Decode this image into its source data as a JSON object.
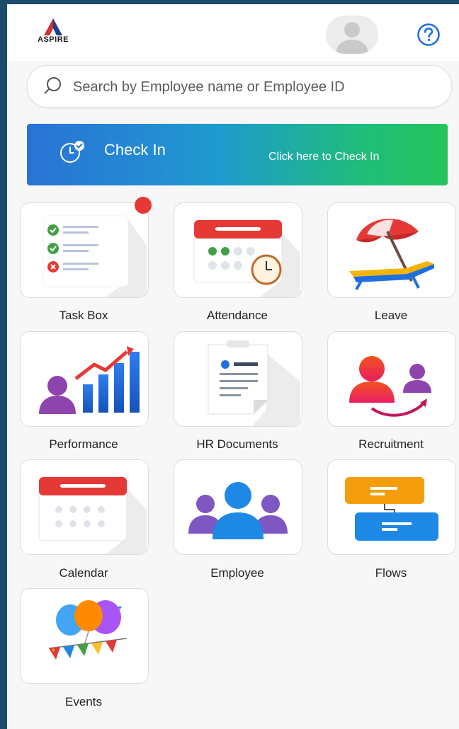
{
  "header": {
    "logo_text": "ASPIRE"
  },
  "search": {
    "placeholder": "Search by Employee name or Employee ID"
  },
  "checkin": {
    "title": "Check In",
    "subtitle": "Click here to Check In"
  },
  "modules": [
    {
      "label": "Task Box",
      "icon": "task-box-icon",
      "has_notification": true
    },
    {
      "label": "Attendance",
      "icon": "attendance-icon"
    },
    {
      "label": "Leave",
      "icon": "leave-icon"
    },
    {
      "label": "Performance",
      "icon": "performance-icon"
    },
    {
      "label": "HR Documents",
      "icon": "hr-documents-icon"
    },
    {
      "label": "Recruitment",
      "icon": "recruitment-icon"
    },
    {
      "label": "Calendar",
      "icon": "calendar-icon"
    },
    {
      "label": "Employee",
      "icon": "employee-icon"
    },
    {
      "label": "Flows",
      "icon": "flows-icon"
    },
    {
      "label": "Events",
      "icon": "events-icon"
    }
  ],
  "colors": {
    "outer_border": "#1b4a6b",
    "help_icon": "#1e6fe0",
    "notification": "#e53935",
    "checkin_start": "#2a72d6",
    "checkin_end": "#25c45a"
  }
}
